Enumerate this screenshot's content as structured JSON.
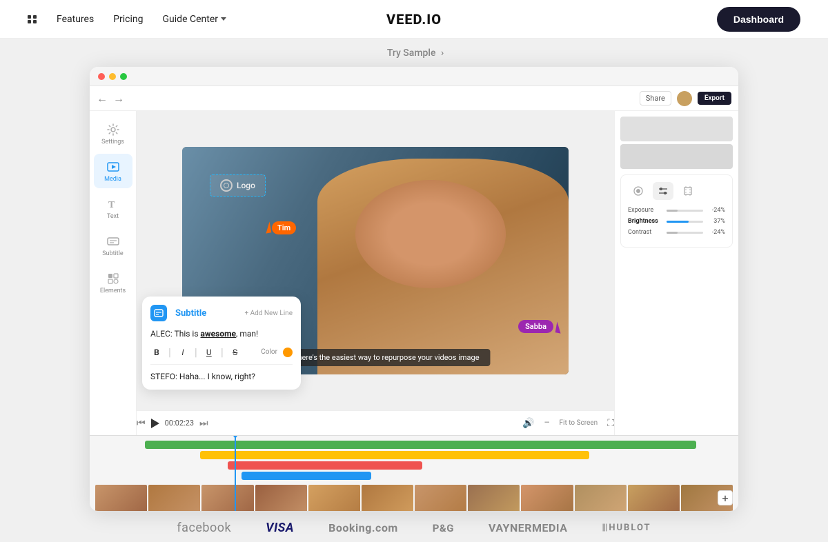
{
  "nav": {
    "features_label": "Features",
    "pricing_label": "Pricing",
    "guide_label": "Guide Center",
    "logo": "VEED.IO",
    "dashboard_label": "Dashboard",
    "try_sample": "Try Sample",
    "try_sample_arrow": "›"
  },
  "editor": {
    "export_label": "Export",
    "share_label": "Share",
    "playback_time": "00:02:23",
    "fit_screen": "Fit to Screen",
    "sidebar": {
      "items": [
        {
          "label": "Settings",
          "active": false
        },
        {
          "label": "Media",
          "active": true
        },
        {
          "label": "Text",
          "active": false
        },
        {
          "label": "Subtitle",
          "active": false
        },
        {
          "label": "Elements",
          "active": false
        }
      ]
    },
    "video": {
      "subtitle_text": "DIANA: here's the easiest way to repurpose your videos image",
      "logo_text": "Logo"
    },
    "cursor_tim": "Tim",
    "cursor_sabba": "Sabba",
    "adjustments": {
      "exposure_label": "Exposure",
      "exposure_val": "-24%",
      "brightness_label": "Brightness",
      "brightness_val": "37%",
      "brightness_fill": "60",
      "contrast_label": "Contrast",
      "contrast_val": "-24%"
    },
    "subtitle_panel": {
      "title": "Subtitle",
      "add_line": "+ Add New Line",
      "line1": "ALEC: This is awesome, man!",
      "line1_bold": "awesome",
      "bold_btn": "B",
      "italic_btn": "I",
      "underline_btn": "U",
      "strikethrough_btn": "S",
      "color_label": "Color",
      "line2": "STEFO: Haha... I know, right?"
    }
  },
  "brands": [
    {
      "name": "facebook",
      "display": "facebook"
    },
    {
      "name": "visa",
      "display": "VISA"
    },
    {
      "name": "booking",
      "display": "Booking.com"
    },
    {
      "name": "pg",
      "display": "P&G"
    },
    {
      "name": "vaynermedia",
      "display": "VAYNERMEDIA"
    },
    {
      "name": "hublot",
      "display": "HUBLOT"
    }
  ]
}
